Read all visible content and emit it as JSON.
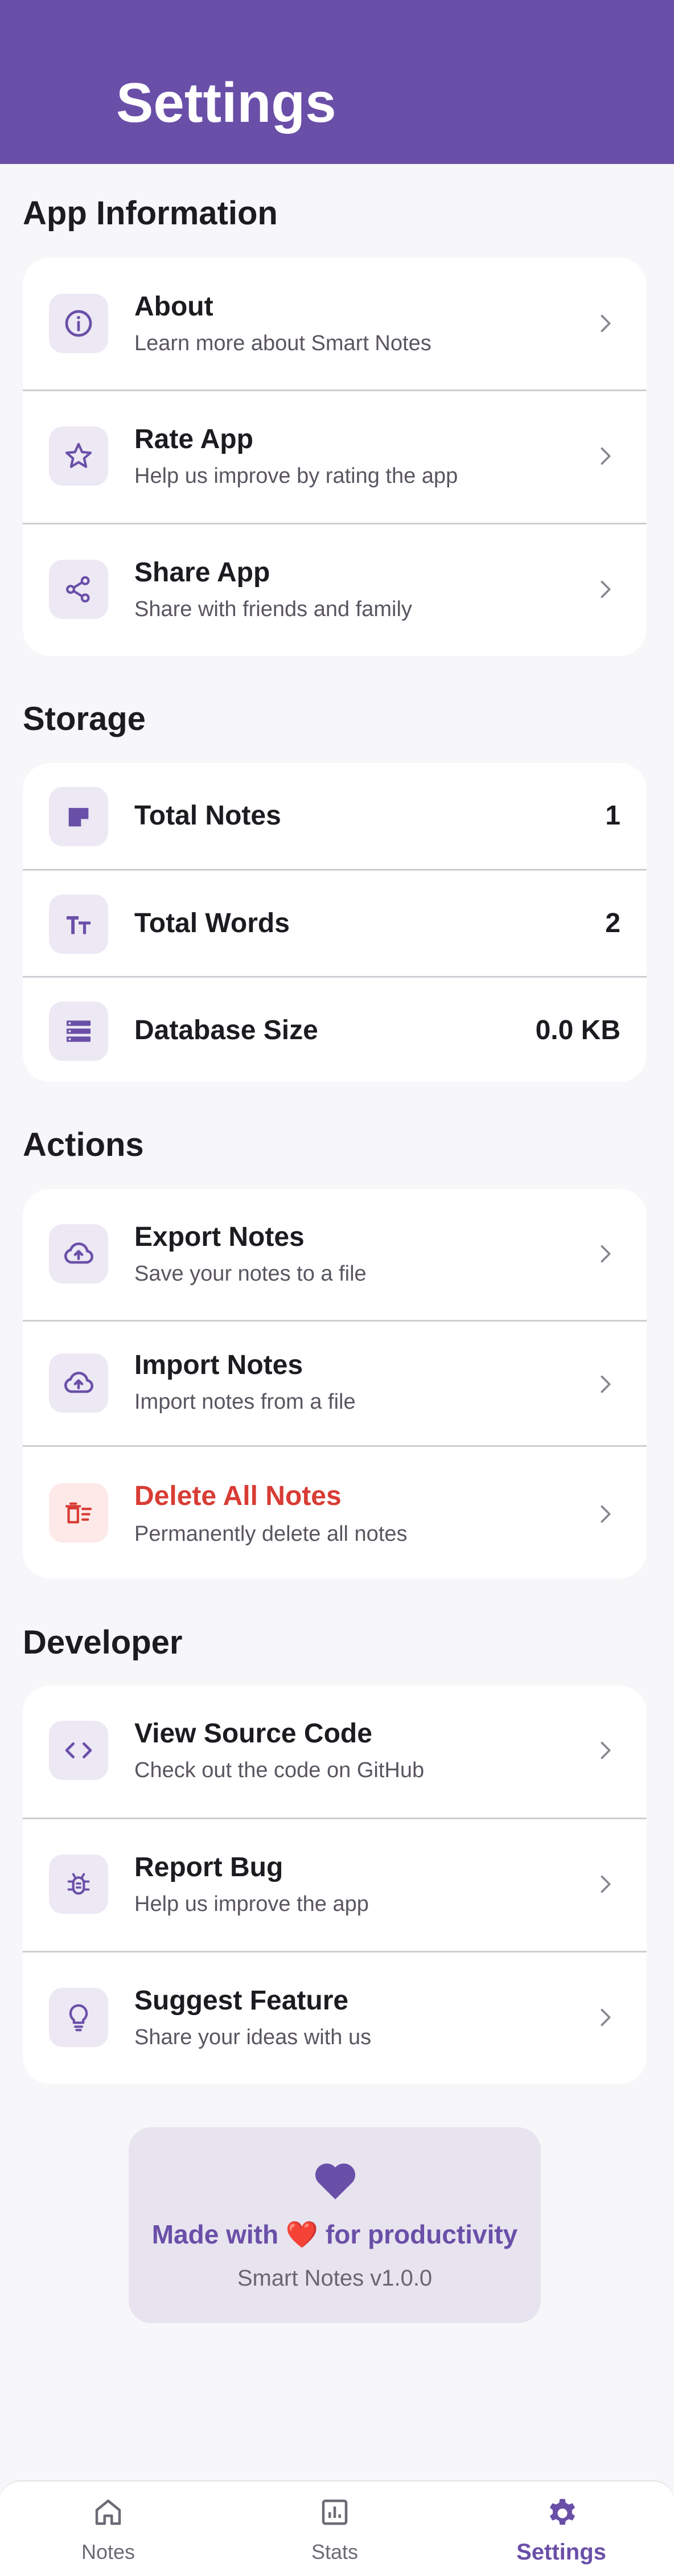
{
  "header": {
    "title": "Settings"
  },
  "sections": {
    "app_info": {
      "title": "App Information",
      "items": [
        {
          "title": "About",
          "subtitle": "Learn more about Smart Notes",
          "icon": "info-icon"
        },
        {
          "title": "Rate App",
          "subtitle": "Help us improve by rating the app",
          "icon": "star-icon"
        },
        {
          "title": "Share App",
          "subtitle": "Share with friends and family",
          "icon": "share-icon"
        }
      ]
    },
    "storage": {
      "title": "Storage",
      "items": [
        {
          "title": "Total Notes",
          "value": "1",
          "icon": "note-icon"
        },
        {
          "title": "Total Words",
          "value": "2",
          "icon": "text-size-icon"
        },
        {
          "title": "Database Size",
          "value": "0.0 KB",
          "icon": "storage-icon"
        }
      ]
    },
    "actions": {
      "title": "Actions",
      "items": [
        {
          "title": "Export Notes",
          "subtitle": "Save your notes to a file",
          "icon": "cloud-upload-icon"
        },
        {
          "title": "Import Notes",
          "subtitle": "Import notes from a file",
          "icon": "cloud-upload-icon"
        },
        {
          "title": "Delete All Notes",
          "subtitle": "Permanently delete all notes",
          "icon": "delete-sweep-icon"
        }
      ]
    },
    "developer": {
      "title": "Developer",
      "items": [
        {
          "title": "View Source Code",
          "subtitle": "Check out the code on GitHub",
          "icon": "code-icon"
        },
        {
          "title": "Report Bug",
          "subtitle": "Help us improve the app",
          "icon": "bug-icon"
        },
        {
          "title": "Suggest Feature",
          "subtitle": "Share your ideas with us",
          "icon": "lightbulb-icon"
        }
      ]
    }
  },
  "footer": {
    "made_with": "Made with ❤️ for productivity",
    "version": "Smart Notes v1.0.0",
    "icon": "heart-icon"
  },
  "bottom_nav": {
    "items": [
      {
        "label": "Notes",
        "icon": "home-icon",
        "active": false
      },
      {
        "label": "Stats",
        "icon": "stats-icon",
        "active": false
      },
      {
        "label": "Settings",
        "icon": "settings-gear-icon",
        "active": true
      }
    ]
  },
  "colors": {
    "primary": "#6a4fa8",
    "danger": "#d83c34",
    "background": "#f7f6f8",
    "card": "#ffffff"
  }
}
